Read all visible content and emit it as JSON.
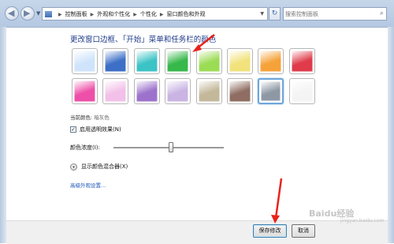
{
  "address_bar": {
    "crumbs": [
      "控制面板",
      "外观和个性化",
      "个性化",
      "窗口颜色和外观"
    ]
  },
  "search": {
    "placeholder": "搜索控制面板"
  },
  "heading": "更改窗口边框、「开始」菜单和任务栏的颜色",
  "swatches": [
    {
      "name": "sky",
      "color": "#cfe4fb"
    },
    {
      "name": "twilight",
      "color": "#3d6fc7"
    },
    {
      "name": "sea",
      "color": "#3cc3c6"
    },
    {
      "name": "leaf",
      "color": "#37b84a"
    },
    {
      "name": "lime",
      "color": "#9bdc55"
    },
    {
      "name": "lemon",
      "color": "#f1e27c"
    },
    {
      "name": "pumpkin",
      "color": "#f5a23a"
    },
    {
      "name": "ruby",
      "color": "#df3b4a"
    },
    {
      "name": "fuchsia",
      "color": "#ee4fa8"
    },
    {
      "name": "blush",
      "color": "#f2c0e8"
    },
    {
      "name": "violet",
      "color": "#9c72cc"
    },
    {
      "name": "lavender",
      "color": "#c9b4e4"
    },
    {
      "name": "taupe",
      "color": "#c3b89a"
    },
    {
      "name": "chocolate",
      "color": "#8f6d62"
    },
    {
      "name": "slate",
      "color": "#8e98a5"
    },
    {
      "name": "frost",
      "color": "#f4f4f4"
    }
  ],
  "selected_swatch": "slate",
  "current_color": {
    "label": "当前颜色:",
    "value": "暗灰色"
  },
  "transparency": {
    "label": "启用透明效果(N)",
    "checked": true,
    "mark": "✓"
  },
  "intensity": {
    "label": "颜色浓度(I):",
    "level": 0.52
  },
  "mixer": {
    "label": "显示颜色混合器(X)",
    "icon": "chevron-down-icon",
    "glyph": "▾"
  },
  "advanced_link": "高级外观设置...",
  "buttons": {
    "save": "保存修改",
    "cancel": "取消"
  },
  "watermark": {
    "text": "Baidu经验",
    "sub": "jingyan.baidu.com"
  },
  "annotation_color": "#e8231c"
}
